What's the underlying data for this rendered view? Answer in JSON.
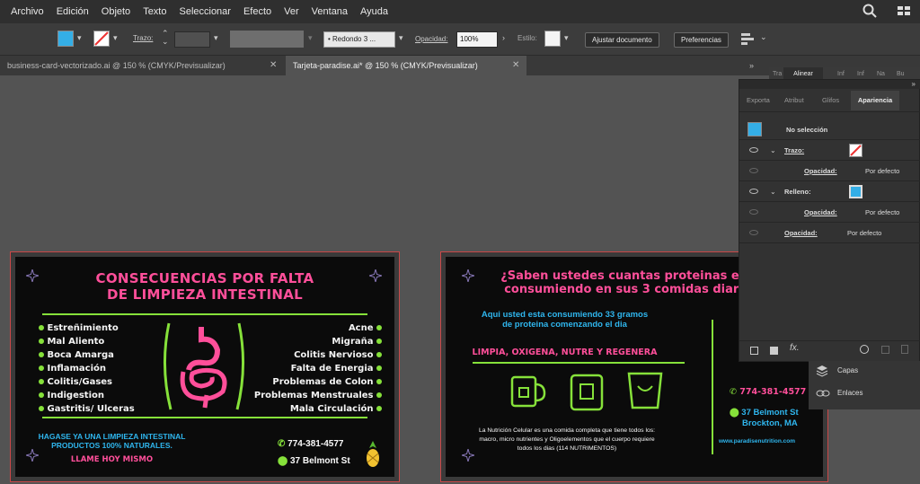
{
  "menu": [
    "Archivo",
    "Edición",
    "Objeto",
    "Texto",
    "Seleccionar",
    "Efecto",
    "Ver",
    "Ventana",
    "Ayuda"
  ],
  "icons": {
    "search": "search-icon",
    "workspace": "workspace-grid-icon"
  },
  "control": {
    "stroke_label": "Trazo:",
    "brush_value": "Redondo 3 ...",
    "opacity_label": "Opacidad:",
    "opacity_value": "100%",
    "style_label": "Estilo:",
    "adjust_button": "Ajustar documento",
    "prefs_button": "Preferencias"
  },
  "tabs": [
    {
      "label": "business-card-vectorizado.ai @ 150 % (CMYK/Previsualizar)",
      "active": false
    },
    {
      "label": "Tarjeta-paradise.ai* @ 150 % (CMYK/Previsualizar)",
      "active": true
    }
  ],
  "dock_tabs": [
    "Tra",
    "Alinear",
    "Inf",
    "Inf",
    "Na",
    "Bu"
  ],
  "panel": {
    "tabs": [
      "Exporta",
      "Atribut",
      "Glifos",
      "Apariencia"
    ],
    "no_selection": "No selección",
    "stroke": "Trazo:",
    "opacity": "Opacidad:",
    "default": "Por defecto",
    "fill": "Relleno:"
  },
  "side_panel": {
    "layers": "Capas",
    "links": "Enlaces"
  },
  "card1": {
    "title1": "CONSECUENCIAS POR FALTA",
    "title2": "DE LIMPIEZA INTESTINAL",
    "left": [
      "Estreñimiento",
      "Mal Aliento",
      "Boca Amarga",
      "Inflamación",
      "Colitis/Gases",
      "Indigestion",
      "Gastritis/ Ulceras"
    ],
    "right": [
      "Acne",
      "Migraña",
      "Colitis Nervioso",
      "Falta de Energia",
      "Problemas de Colon",
      "Problemas Menstruales",
      "Mala Circulación"
    ],
    "promo1": "HAGASE YA UNA LIMPIEZA INTESTINAL",
    "promo2": "PRODUCTOS 100% NATURALES.",
    "cta": "LLAME HOY MISMO",
    "phone": "774-381-4577",
    "address": "37 Belmont St"
  },
  "card2": {
    "title1": "¿Saben ustedes cuantas proteinas estan",
    "title2": "consumiendo en sus 3 comidas diarias?",
    "sub1": "Aqui usted esta consumiendo 33 gramos",
    "sub2": "de proteina comenzando el dia",
    "tagline": "LIMPIA, OXIGENA, NUTRE Y REGENERA",
    "body1": "La Nutrición Celular es una comida completa que tiene todos los:",
    "body2": "macro, micro nutrientes y Oligoelementos que el cuerpo requiere",
    "body3": "todos los dias (114 NUTRIMENTOS)",
    "phone": "774-381-4577",
    "address1": "37 Belmont St",
    "address2": "Brockton, MA",
    "web": "www.paradisenutrition.com"
  },
  "colors": {
    "pink": "#ff4f9a",
    "green": "#86e13a",
    "cyan": "#2fb6ee",
    "panel": "#323232",
    "bg": "#535353"
  }
}
